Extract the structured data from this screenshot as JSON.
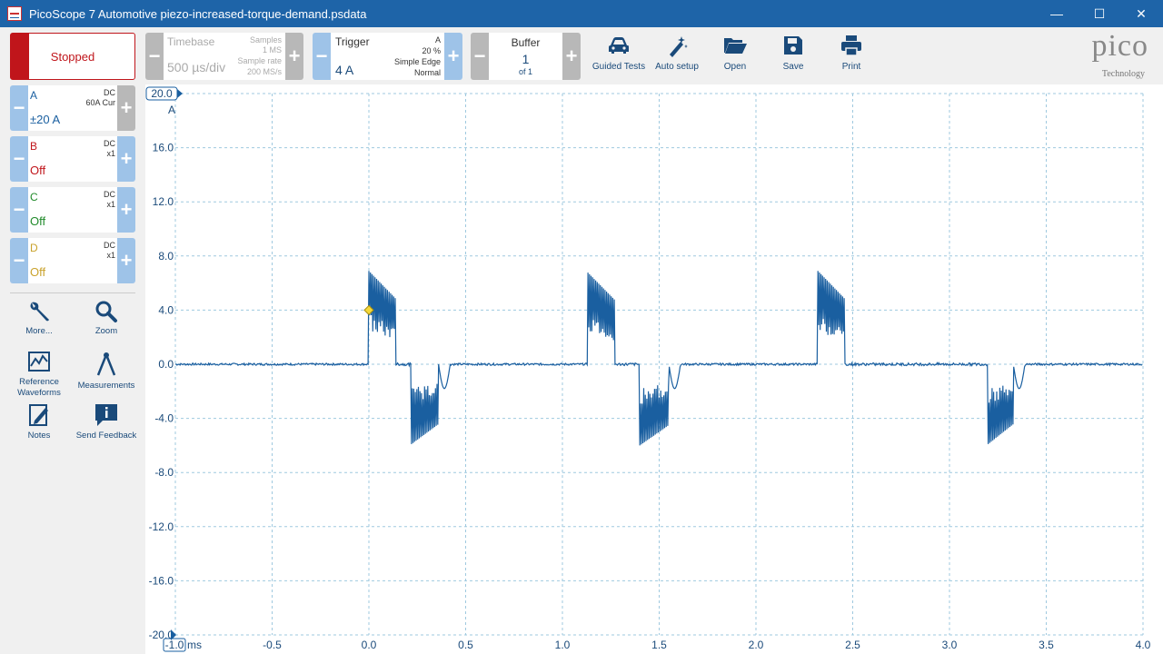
{
  "window": {
    "title": "PicoScope 7 Automotive piezo-increased-torque-demand.psdata",
    "minimize": "—",
    "maximize": "☐",
    "close": "✕"
  },
  "toolbar": {
    "run_state": "Stopped",
    "timebase": {
      "label": "Timebase",
      "value": "500 µs/div",
      "samples_label": "Samples",
      "samples_value": "1 MS",
      "rate_label": "Sample rate",
      "rate_value": "200 MS/s"
    },
    "trigger": {
      "label": "Trigger",
      "value": "4 A",
      "channel": "A",
      "percent": "20 %",
      "type": "Simple Edge",
      "mode": "Normal"
    },
    "buffer": {
      "label": "Buffer",
      "value": "1",
      "of": "of 1"
    },
    "tools": [
      "Guided Tests",
      "Auto setup",
      "Open",
      "Save",
      "Print"
    ],
    "minus": "−",
    "plus": "+"
  },
  "brand": {
    "logo": "pico",
    "subtitle": "Technology"
  },
  "channels": [
    {
      "name": "A",
      "coupling": "DC",
      "probe": "60A Cur",
      "range": "±20 A",
      "color": "#1a5fa0"
    },
    {
      "name": "B",
      "coupling": "DC",
      "probe": "x1",
      "range": "Off",
      "color": "#c0151b"
    },
    {
      "name": "C",
      "coupling": "DC",
      "probe": "x1",
      "range": "Off",
      "color": "#208a2a"
    },
    {
      "name": "D",
      "coupling": "DC",
      "probe": "x1",
      "range": "Off",
      "color": "#c9a22c"
    }
  ],
  "side_tools": {
    "more": "More...",
    "zoom": "Zoom",
    "reference_line1": "Reference",
    "reference_line2": "Waveforms",
    "measurements": "Measurements",
    "notes": "Notes",
    "feedback": "Send Feedback"
  },
  "chart_data": {
    "type": "line",
    "y_unit": "A",
    "x_unit": "ms",
    "ylim": [
      -20.0,
      20.0
    ],
    "xlim": [
      -1.0,
      4.0
    ],
    "y_ticks": [
      "20.0",
      "16.0",
      "12.0",
      "8.0",
      "4.0",
      "0.0",
      "-4.0",
      "-8.0",
      "-12.0",
      "-16.0",
      "-20.0"
    ],
    "x_ticks": [
      "-1.0",
      "-0.5",
      "0.0",
      "0.5",
      "1.0",
      "1.5",
      "2.0",
      "2.5",
      "3.0",
      "3.5",
      "4.0"
    ],
    "grid": true,
    "trigger_marker": {
      "x": 0.0,
      "y": 4.0
    },
    "series": [
      {
        "color": "#1a5fa0",
        "bursts": [
          {
            "start": 0.0,
            "positive_end": 0.14,
            "positive_peak": 6.9,
            "negative_start": 0.22,
            "negative_end": 0.36,
            "negative_peak": -5.9
          },
          {
            "start": 1.13,
            "positive_end": 1.27,
            "positive_peak": 6.8,
            "negative_start": 1.4,
            "negative_end": 1.55,
            "negative_peak": -6.0
          },
          {
            "start": 2.32,
            "positive_end": 2.46,
            "positive_peak": 6.9,
            "negative_start": 3.2,
            "negative_end": 3.33,
            "negative_peak": -5.9
          }
        ]
      }
    ]
  }
}
